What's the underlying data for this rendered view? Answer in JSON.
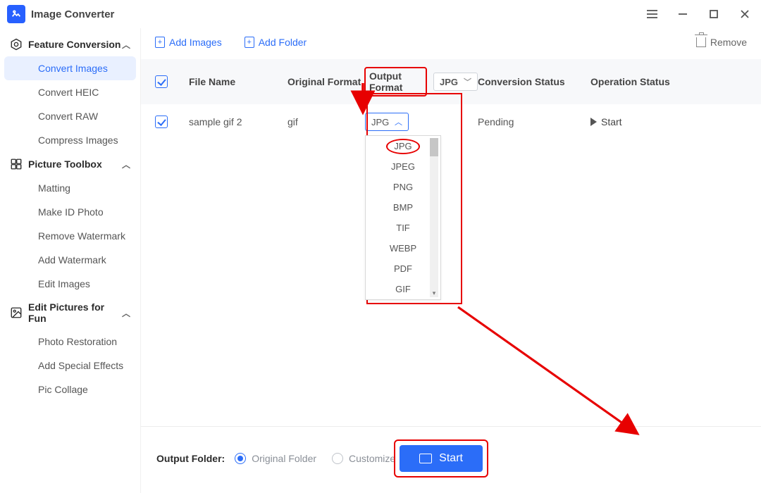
{
  "app": {
    "title": "Image Converter"
  },
  "window_controls": {
    "menu": "menu",
    "minimize": "minimize",
    "maximize": "maximize",
    "close": "close"
  },
  "sidebar": {
    "sections": [
      {
        "title": "Feature Conversion",
        "items": [
          "Convert Images",
          "Convert HEIC",
          "Convert RAW",
          "Compress Images"
        ],
        "active_index": 0
      },
      {
        "title": "Picture Toolbox",
        "items": [
          "Matting",
          "Make ID Photo",
          "Remove Watermark",
          "Add Watermark",
          "Edit Images"
        ]
      },
      {
        "title": "Edit Pictures for Fun",
        "items": [
          "Photo Restoration",
          "Add Special Effects",
          "Pic Collage"
        ]
      }
    ]
  },
  "toolbar": {
    "add_images": "Add Images",
    "add_folder": "Add Folder",
    "remove": "Remove"
  },
  "table": {
    "columns": {
      "file_name": "File Name",
      "original_format": "Original Format",
      "output_format": "Output Format",
      "conversion_status": "Conversion Status",
      "operation_status": "Operation Status"
    },
    "header_output_select": "JPG",
    "rows": [
      {
        "file_name": "sample gif 2",
        "original_format": "gif",
        "output_format_selected": "JPG",
        "conversion_status": "Pending",
        "operation_label": "Start"
      }
    ],
    "output_format_options": [
      "JPG",
      "JPEG",
      "PNG",
      "BMP",
      "TIF",
      "WEBP",
      "PDF",
      "GIF"
    ]
  },
  "footer": {
    "label": "Output Folder:",
    "option_original": "Original Folder",
    "option_customize": "Customize",
    "selected": "original",
    "start": "Start"
  }
}
